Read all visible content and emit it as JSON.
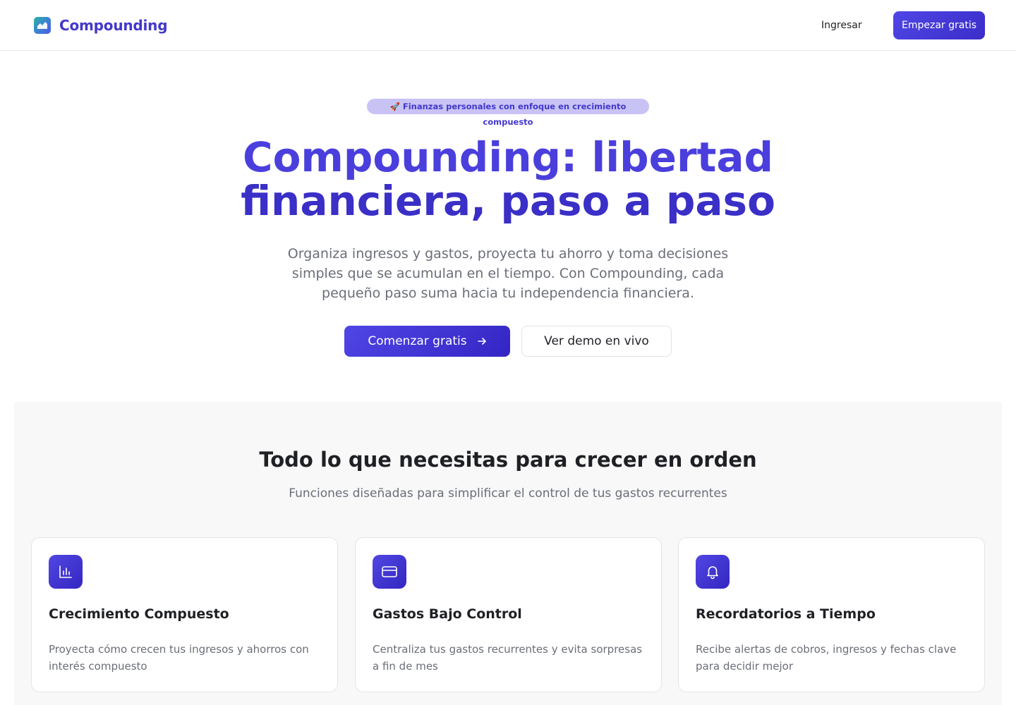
{
  "header": {
    "brand_name": "Compounding",
    "login_label": "Ingresar",
    "cta_label": "Empezar gratis"
  },
  "hero": {
    "badge": "🚀 Finanzas personales con enfoque en crecimiento compuesto",
    "title_line1": "Compounding: libertad",
    "title_line2": "financiera, paso a paso",
    "subtitle": "Organiza ingresos y gastos, proyecta tu ahorro y toma decisiones simples que se acumulan en el tiempo. Con Compounding, cada pequeño paso suma hacia tu independencia financiera.",
    "primary_button": "Comenzar gratis",
    "secondary_button": "Ver demo en vivo"
  },
  "features": {
    "title": "Todo lo que necesitas para crecer en orden",
    "subtitle": "Funciones diseñadas para simplificar el control de tus gastos recurrentes",
    "cards": [
      {
        "icon": "bar-chart-icon",
        "title": "Crecimiento Compuesto",
        "description": "Proyecta cómo crecen tus ingresos y ahorros con interés compuesto"
      },
      {
        "icon": "credit-card-icon",
        "title": "Gastos Bajo Control",
        "description": "Centraliza tus gastos recurrentes y evita sorpresas a fin de mes"
      },
      {
        "icon": "bell-icon",
        "title": "Recordatorios a Tiempo",
        "description": "Recibe alertas de cobros, ingresos y fechas clave para decidir mejor"
      }
    ]
  },
  "colors": {
    "brand": "#4338ca",
    "accent_gradient_start": "#4f46e5",
    "accent_gradient_end": "#3325c4",
    "muted_text": "#6b6e78",
    "section_bg": "#f8f8f9"
  }
}
